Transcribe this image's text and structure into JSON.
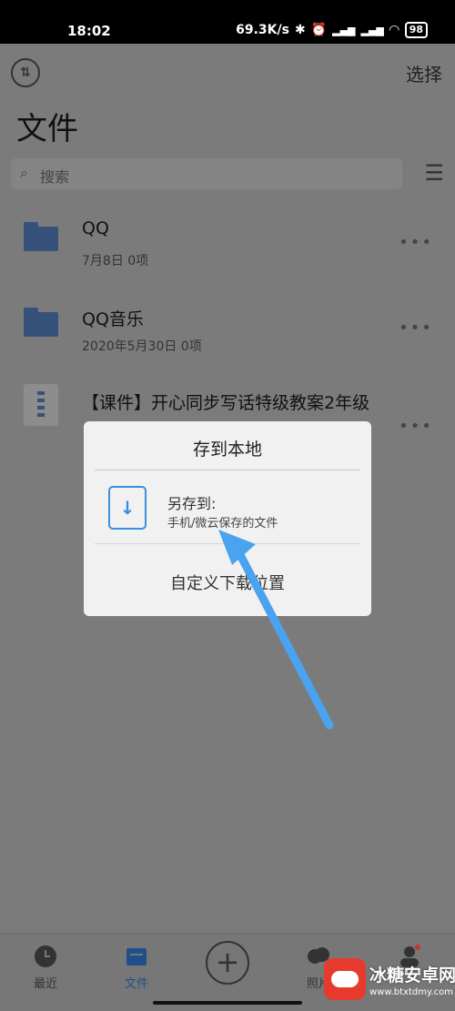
{
  "status_bar": {
    "time": "18:02",
    "net_speed": "69.3K/s",
    "battery": "98"
  },
  "header": {
    "title": "文件",
    "select_label": "选择"
  },
  "search": {
    "placeholder": "搜索"
  },
  "files": [
    {
      "name": "QQ",
      "meta": "7月8日  0项",
      "icon": "folder-icon"
    },
    {
      "name": "QQ音乐",
      "meta": "2020年5月30日  0项",
      "icon": "folder-icon"
    },
    {
      "name": "【课件】开心同步写话特级教案2年级",
      "meta": "",
      "icon": "zip-file-icon"
    }
  ],
  "dialog": {
    "title": "存到本地",
    "save_as_title": "另存到:",
    "save_as_subtitle": "手机/微云保存的文件",
    "custom_location": "自定义下载位置"
  },
  "tabbar": {
    "recent": "最近",
    "files": "文件",
    "photos": "照片"
  },
  "watermark": {
    "brand": "冰糖安卓网",
    "url": "www.btxtdmy.com"
  },
  "colors": {
    "accent": "#3b8fe0",
    "arrow": "#4aa3f0",
    "folder": "#36517a",
    "scrim": "#7b7b7b"
  }
}
